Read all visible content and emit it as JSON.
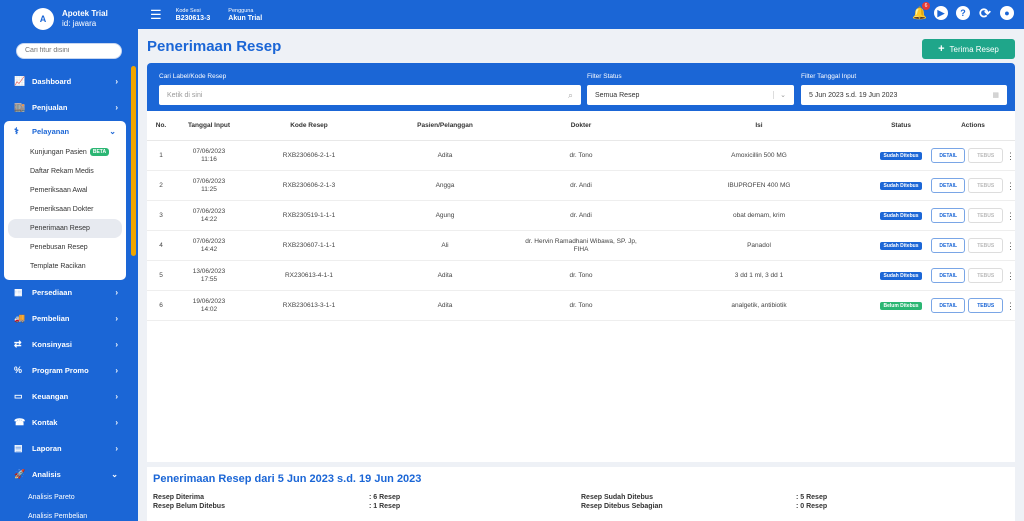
{
  "brand": {
    "logo": "A",
    "name": "Apotek Trial",
    "id": "id: jawara"
  },
  "sidebar": {
    "search_placeholder": "Cari fitur disini",
    "items_before": [
      {
        "label": "Dashboard",
        "icon": "chart-icon",
        "glyph": "📈"
      },
      {
        "label": "Penjualan",
        "icon": "store-icon",
        "glyph": "🏬"
      }
    ],
    "open": {
      "label": "Pelayanan",
      "glyph": "⚕",
      "chevron": "⌄",
      "subs": [
        "Kunjungan Pasien",
        "Daftar Rekam Medis",
        "Pemeriksaan Awal",
        "Pemeriksaan Dokter",
        "Penerimaan Resep",
        "Penebusan Resep",
        "Template Racikan"
      ],
      "beta": "BETA"
    },
    "items_after": [
      {
        "label": "Persediaan",
        "icon": "boxes-icon",
        "glyph": "▦"
      },
      {
        "label": "Pembelian",
        "icon": "truck-icon",
        "glyph": "🚚"
      },
      {
        "label": "Konsinyasi",
        "icon": "consign-icon",
        "glyph": "⇄"
      },
      {
        "label": "Program Promo",
        "icon": "percent-icon",
        "glyph": "%"
      },
      {
        "label": "Keuangan",
        "icon": "wallet-icon",
        "glyph": "▭"
      },
      {
        "label": "Kontak",
        "icon": "contact-icon",
        "glyph": "☎"
      },
      {
        "label": "Laporan",
        "icon": "report-icon",
        "glyph": "▤"
      }
    ],
    "analisis": {
      "label": "Analisis",
      "glyph": "🚀",
      "chevron": "⌄",
      "subs": [
        "Analisis Pareto",
        "Analisis Pembelian"
      ]
    },
    "chevron": "›"
  },
  "topbar": {
    "burger": "☰",
    "sesi_label": "Kode Sesi",
    "sesi_value": "B230613-3",
    "pengguna_label": "Pengguna",
    "pengguna_value": "Akun Trial",
    "notif_count": "6",
    "icons": {
      "bell": "🔔",
      "play": "▶",
      "help": "?",
      "refresh": "⟳",
      "user": "●"
    }
  },
  "page": {
    "title": "Penerimaan Resep",
    "add_icon": "+",
    "add_button": "Terima Resep",
    "filter": {
      "search_label": "Cari Label/Kode Resep",
      "search_placeholder": "Ketik di sini",
      "search_icon": "⌕",
      "status_label": "Filter Status",
      "status_value": "Semua Resep",
      "status_chevron": "⌄",
      "date_label": "Filter Tanggal Input",
      "date_value": "5 Jun 2023 s.d. 19 Jun 2023",
      "date_icon": "▦"
    }
  },
  "table": {
    "headers": [
      "No.",
      "Tanggal Input",
      "Kode Resep",
      "Pasien/Pelanggan",
      "Dokter",
      "Isi",
      "Status",
      "Actions"
    ],
    "detail_label": "DETAIL",
    "tebus_label": "TEBUS",
    "kebab": "⋮",
    "rows": [
      {
        "no": "1",
        "date": "07/06/2023",
        "time": "11:16",
        "kode": "RXB230606-2-1-1",
        "pasien": "Adita",
        "dokter": "dr. Tono",
        "isi": "Amoxicillin 500 MG",
        "status": "Sudah Ditebus",
        "status_color": "b",
        "tebus_enabled": false
      },
      {
        "no": "2",
        "date": "07/06/2023",
        "time": "11:25",
        "kode": "RXB230606-2-1-3",
        "pasien": "Angga",
        "dokter": "dr. Andi",
        "isi": "IBUPROFEN 400 MG",
        "status": "Sudah Ditebus",
        "status_color": "b",
        "tebus_enabled": false
      },
      {
        "no": "3",
        "date": "07/06/2023",
        "time": "14:22",
        "kode": "RXB230519-1-1-1",
        "pasien": "Agung",
        "dokter": "dr. Andi",
        "isi": "obat demam, krim",
        "status": "Sudah Ditebus",
        "status_color": "b",
        "tebus_enabled": false
      },
      {
        "no": "4",
        "date": "07/06/2023",
        "time": "14:42",
        "kode": "RXB230607-1-1-1",
        "pasien": "Ali",
        "dokter": "dr. Hervin Ramadhani Wibawa, SP. Jp, FIHA",
        "isi": "Panadol",
        "status": "Sudah Ditebus",
        "status_color": "b",
        "tebus_enabled": false
      },
      {
        "no": "5",
        "date": "13/06/2023",
        "time": "17:55",
        "kode": "RX230613-4-1-1",
        "pasien": "Adita",
        "dokter": "dr. Tono",
        "isi": "3 dd 1 ml, 3 dd 1",
        "status": "Sudah Ditebus",
        "status_color": "b",
        "tebus_enabled": false
      },
      {
        "no": "6",
        "date": "19/06/2023",
        "time": "14:02",
        "kode": "RXB230613-3-1-1",
        "pasien": "Adita",
        "dokter": "dr. Tono",
        "isi": "analgetik, antibiotik",
        "status": "Belum Ditebus",
        "status_color": "g",
        "tebus_enabled": true
      }
    ]
  },
  "summary": {
    "title": "Penerimaan Resep dari 5 Jun 2023 s.d. 19 Jun 2023",
    "diterima_label": "Resep Diterima",
    "diterima_value": ": 6 Resep",
    "belum_label": "Resep Belum Ditebus",
    "belum_value": ": 1 Resep",
    "sudah_label": "Resep Sudah Ditebus",
    "sudah_value": ": 5 Resep",
    "sebagian_label": "Resep Ditebus Sebagian",
    "sebagian_value": ": 0 Resep"
  }
}
